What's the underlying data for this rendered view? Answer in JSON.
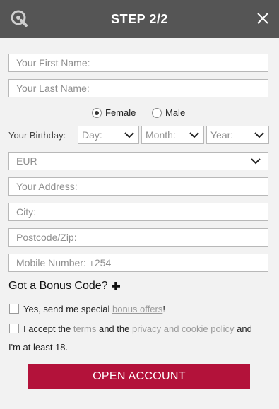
{
  "header": {
    "title": "STEP 2/2",
    "logo_icon": "q-logo-icon",
    "close_icon": "close-icon",
    "background": "#555555"
  },
  "form": {
    "first_name_placeholder": "Your First Name:",
    "last_name_placeholder": "Your Last Name:",
    "gender": {
      "female_label": "Female",
      "male_label": "Male",
      "selected": "Female"
    },
    "birthday": {
      "label": "Your Birthday:",
      "day": "Day:",
      "month": "Month:",
      "year": "Year:"
    },
    "currency": "EUR",
    "address_placeholder": "Your Address:",
    "city_placeholder": "City:",
    "postcode_placeholder": "Postcode/Zip:",
    "mobile_placeholder": "Mobile Number: +254",
    "bonus_code_label": "Got a Bonus Code?",
    "offers": {
      "text_before": "Yes, send me special",
      "link": "bonus offers",
      "text_after": "!"
    },
    "terms": {
      "text1": "I accept the",
      "terms_link": "terms",
      "text2": "and the",
      "privacy_link": "privacy and cookie policy",
      "text3": "and",
      "line2": "I'm at least 18."
    },
    "submit_label": "OPEN ACCOUNT"
  },
  "colors": {
    "accent": "#b3123a",
    "header": "#555555",
    "link": "#9a9a9a"
  }
}
